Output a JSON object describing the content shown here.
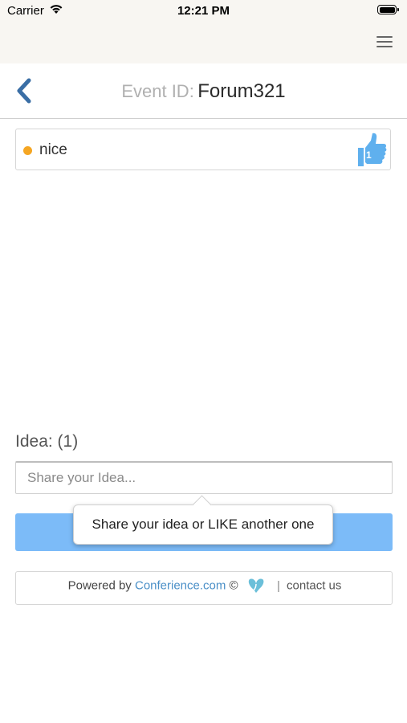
{
  "status_bar": {
    "carrier": "Carrier",
    "time": "12:21 PM"
  },
  "header": {
    "event_label": "Event ID:",
    "event_id": "Forum321"
  },
  "ideas": [
    {
      "text": "nice",
      "likes": "1",
      "dot_color": "#f5a623"
    }
  ],
  "idea_count_label": "Idea: (1)",
  "input": {
    "placeholder": "Share your Idea..."
  },
  "tooltip": {
    "text": "Share your idea or LIKE another one"
  },
  "footer": {
    "powered_by": "Powered by",
    "brand": "Conferience.com",
    "copyright": "©",
    "separator": "|",
    "contact": "contact us"
  },
  "colors": {
    "accent": "#7cbbf8",
    "like": "#5fb0ee",
    "back": "#3a6ea5",
    "top_bar": "#f8f6f2"
  }
}
